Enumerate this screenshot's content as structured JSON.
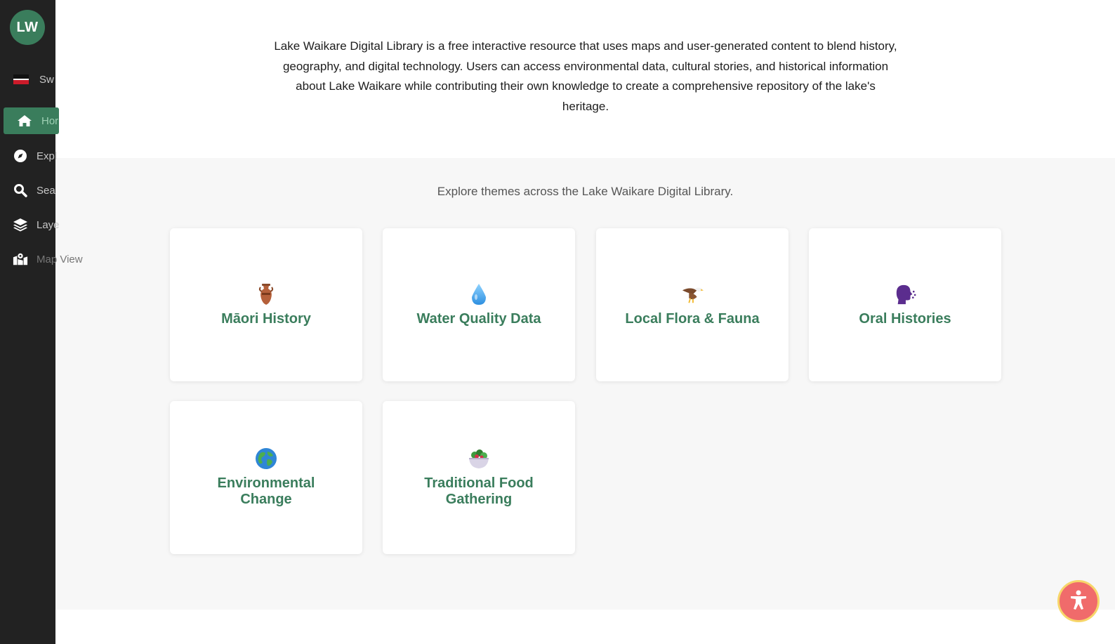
{
  "sidebar": {
    "logo": "LW",
    "items": [
      {
        "label": "Switch Language",
        "icon": "maori-flag-icon"
      },
      {
        "label": "Home",
        "icon": "home-icon",
        "active": true
      },
      {
        "label": "Explore",
        "icon": "compass-icon"
      },
      {
        "label": "Search",
        "icon": "search-icon"
      },
      {
        "label": "Layers",
        "icon": "layers-icon"
      },
      {
        "label": "Map View",
        "icon": "map-marker-icon"
      }
    ],
    "clipped_labels": [
      "Sw",
      "Hor",
      "Expl",
      "Sea",
      "Laye",
      "Map View"
    ]
  },
  "intro": {
    "text": "Lake Waikare Digital Library is a free interactive resource that uses maps and user-generated content to blend history, geography, and digital technology. Users can access environmental data, cultural stories, and historical information about Lake Waikare while contributing their own knowledge to create a comprehensive repository of the lake's heritage."
  },
  "themes": {
    "heading": "Explore themes across the Lake Waikare Digital Library.",
    "cards": [
      {
        "title": "Māori History",
        "icon": "amphora-icon"
      },
      {
        "title": "Water Quality Data",
        "icon": "droplet-icon"
      },
      {
        "title": "Local Flora & Fauna",
        "icon": "eagle-icon"
      },
      {
        "title": "Oral Histories",
        "icon": "speaking-head-icon"
      },
      {
        "title": "Environmental Change",
        "icon": "globe-icon"
      },
      {
        "title": "Traditional Food Gathering",
        "icon": "salad-bowl-icon"
      }
    ]
  },
  "accessibility_button": {
    "icon": "accessibility-icon"
  },
  "colors": {
    "sidebar_bg": "#222222",
    "accent": "#3a7d5c",
    "section_bg": "#f7f7f7",
    "a11y_bg": "#f06b6b"
  }
}
